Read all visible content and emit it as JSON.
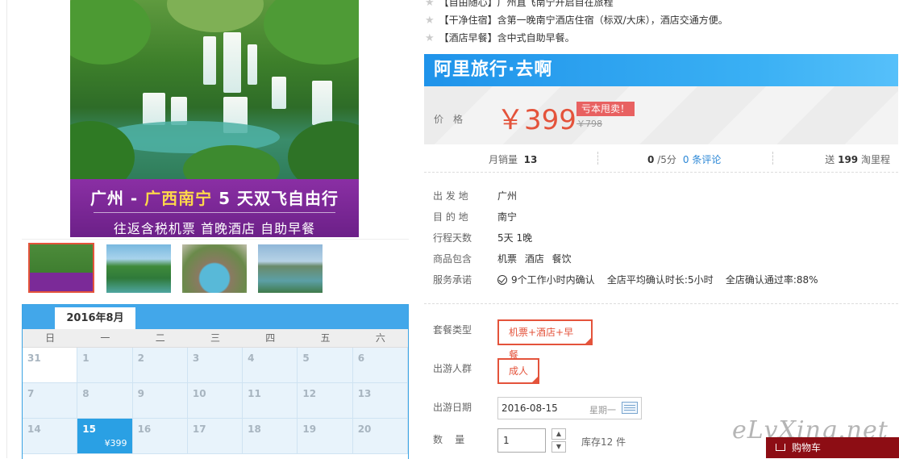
{
  "hero": {
    "title_part1": "广州 - ",
    "title_highlight": "广西南宁",
    "title_part2": " 5 天双飞自由行",
    "subtitle": "往返含税机票  首晚酒店  自助早餐"
  },
  "features": [
    "【自由随心】广州直飞南宁开启自在旅程",
    "【干净住宿】含第一晚南宁酒店住宿（标双/大床），酒店交通方便。",
    "【酒店早餐】含中式自助早餐。"
  ],
  "brand": "阿里旅行·去啊",
  "price": {
    "label": "价格",
    "current": "￥399",
    "tag": "亏本甩卖！",
    "original": "￥798"
  },
  "stats": {
    "monthly_sales_label": "月销量",
    "monthly_sales": "13",
    "rating": "0",
    "rating_suffix": "/5分",
    "reviews": "0 条评论",
    "mileage_prefix": "送",
    "mileage": "199",
    "mileage_suffix": "淘里程"
  },
  "info": {
    "depart_label": "出 发 地",
    "depart": "广州",
    "dest_label": "目 的 地",
    "dest": "南宁",
    "days_label": "行程天数",
    "days": "5天 1晚",
    "includes_label": "商品包含",
    "includes": "机票   酒店   餐饮",
    "promise_label": "服务承诺",
    "promise_1": "9个工作小时内确认",
    "promise_2": "全店平均确认时长:5小时",
    "promise_3": "全店确认通过率:88%"
  },
  "options": {
    "package_label": "套餐类型",
    "package_value": "机票+酒店+早餐",
    "crowd_label": "出游人群",
    "crowd_value": "成人",
    "date_label": "出游日期",
    "date_value": "2016-08-15",
    "date_weekday": "星期一",
    "qty_label": "数    量",
    "qty_value": "1",
    "stock": "库存12 件"
  },
  "calendar": {
    "month": "2016年8月",
    "weekdays": [
      "日",
      "一",
      "二",
      "三",
      "四",
      "五",
      "六"
    ],
    "days": [
      "31",
      "1",
      "2",
      "3",
      "4",
      "5",
      "6",
      "7",
      "8",
      "9",
      "10",
      "11",
      "12",
      "13",
      "14",
      "15",
      "16",
      "17",
      "18",
      "19",
      "20"
    ],
    "selected_price": "¥399"
  },
  "watermark": "eLvXing.net",
  "cart_label": "购物车",
  "colors": {
    "accent": "#e4533b",
    "brand_blue": "#2a9ff0",
    "hero_purple": "#7a2797",
    "cart": "#8d0d14"
  }
}
